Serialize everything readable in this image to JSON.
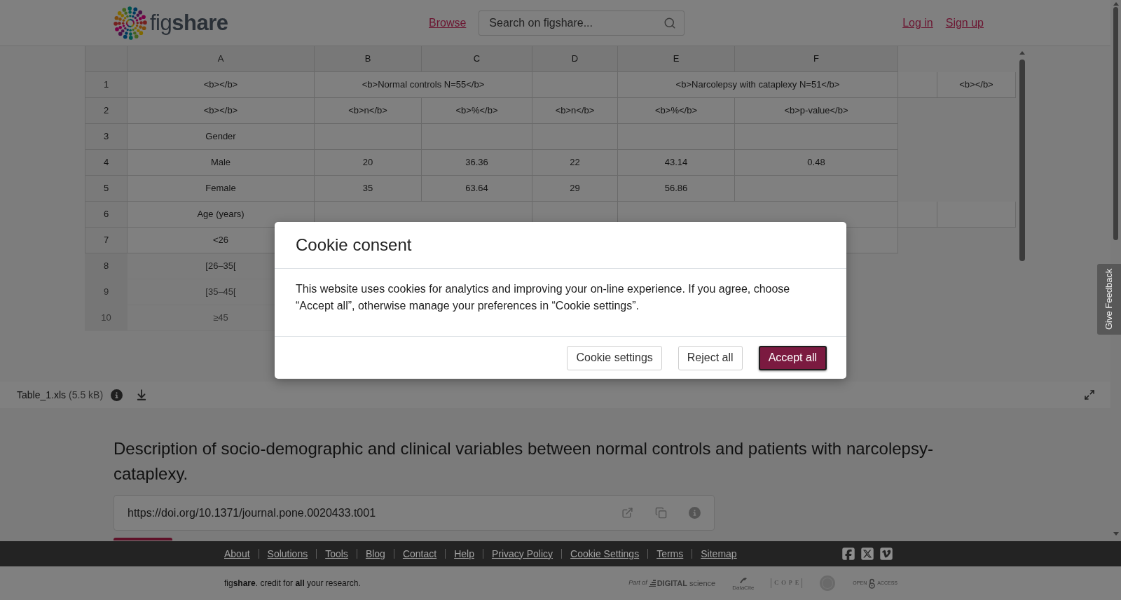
{
  "header": {
    "logo_text": "fig**share**",
    "nav_link": "Browse",
    "search": {
      "placeholder": "Search on figshare..."
    },
    "auth_links": [
      "Log in",
      "Sign up"
    ]
  },
  "spreadsheet": {
    "columns": [
      "A",
      "B",
      "C",
      "D",
      "E",
      "F"
    ],
    "rows": [
      {
        "number": "1",
        "blurred": false,
        "cells": [
          {
            "text": "<b></b>"
          },
          {
            "text": "<b>Normal controls N=55</b>",
            "colspan": 2
          },
          {
            "text": ""
          },
          {
            "text": "<b>Narcolepsy with cataplexy N=51</b>",
            "colspan": 2
          },
          {
            "text": ""
          },
          {
            "text": "<b></b>"
          }
        ]
      },
      {
        "number": "2",
        "blurred": false,
        "cells": [
          {
            "text": "<b></b>"
          },
          {
            "text": "<b>n</b>"
          },
          {
            "text": "<b>%</b>"
          },
          {
            "text": "<b>n</b>"
          },
          {
            "text": "<b>%</b>"
          },
          {
            "text": "<b>p-value</b>"
          }
        ]
      },
      {
        "number": "3",
        "blurred": false,
        "cells": [
          {
            "text": "Gender"
          },
          {
            "text": ""
          },
          {
            "text": ""
          },
          {
            "text": ""
          },
          {
            "text": ""
          },
          {
            "text": ""
          }
        ]
      },
      {
        "number": "4",
        "blurred": false,
        "cells": [
          {
            "text": "Male"
          },
          {
            "text": "20"
          },
          {
            "text": "36.36"
          },
          {
            "text": "22"
          },
          {
            "text": "43.14"
          },
          {
            "text": "0.48"
          }
        ]
      },
      {
        "number": "5",
        "blurred": false,
        "cells": [
          {
            "text": "Female"
          },
          {
            "text": "35"
          },
          {
            "text": "63.64"
          },
          {
            "text": "29"
          },
          {
            "text": "56.86"
          },
          {
            "text": ""
          }
        ]
      },
      {
        "number": "6",
        "blurred": false,
        "cells": [
          {
            "text": "Age (years)"
          },
          {
            "text": "",
            "colspan": 2
          },
          {
            "text": ""
          },
          {
            "text": "",
            "colspan": 2
          },
          {
            "text": ""
          },
          {
            "text": ""
          }
        ]
      },
      {
        "number": "7",
        "blurred": false,
        "cells": [
          {
            "text": "<26"
          },
          {
            "text": ""
          },
          {
            "text": ""
          },
          {
            "text": ""
          },
          {
            "text": ""
          },
          {
            "text": ""
          }
        ]
      },
      {
        "number": "8",
        "blurred": true,
        "cells": [
          {
            "text": "[26–35["
          }
        ]
      },
      {
        "number": "9",
        "blurred": true,
        "cells": [
          {
            "text": "[35–45["
          }
        ]
      },
      {
        "number": "10",
        "blurred": true,
        "cells": [
          {
            "text": "≥45"
          }
        ]
      }
    ]
  },
  "file_bar": {
    "name": "Table_1.xls",
    "size": "(5.5 kB)"
  },
  "feedback_tab": {
    "label": "Give Feedback"
  },
  "description": {
    "title": "Description of socio-demographic and clinical variables between normal controls and patients with narcolepsy-cataplexy.",
    "doi": "https://doi.org/10.1371/journal.pone.0020433.t001"
  },
  "cookie_dialog": {
    "title": "Cookie consent",
    "body": "This website uses cookies for analytics and improving your on-line experience. If you agree, choose “Accept all”, otherwise manage your preferences in “Cookie settings”.",
    "buttons": [
      {
        "label": "Cookie settings",
        "kind": "secondary",
        "focused": false
      },
      {
        "label": "Reject all",
        "kind": "secondary",
        "focused": false
      },
      {
        "label": "Accept all",
        "kind": "primary",
        "focused": true
      }
    ]
  },
  "footer": {
    "links": [
      "About",
      "Solutions",
      "Tools",
      "Blog",
      "Contact",
      "Help",
      "Privacy Policy",
      "Cookie Settings",
      "Terms",
      "Sitemap"
    ],
    "tagline": "fig**share**. credit for **all** your research.",
    "partner_logos": [
      {
        "kind": "digital_science",
        "prefix": "Part of",
        "name": "**DIGITAL** science"
      },
      {
        "kind": "datacite",
        "name": "DataCite"
      },
      {
        "kind": "cope",
        "name": "COPE"
      },
      {
        "kind": "open_access",
        "prefix": "OPEN",
        "name": "ACCESS"
      }
    ]
  }
}
